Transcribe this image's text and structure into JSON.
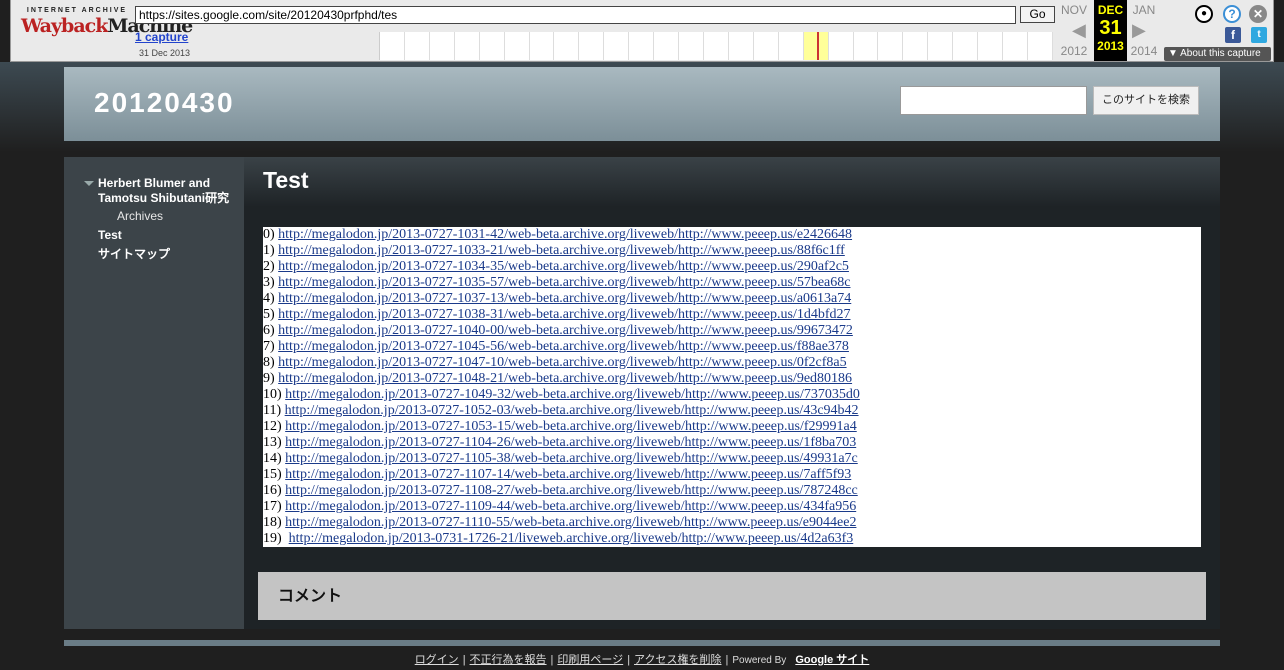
{
  "wayback": {
    "logo_top": "INTERNET ARCHIVE",
    "logo_main_a": "Wayback",
    "logo_main_b": "Machine",
    "url": "https://sites.google.com/site/20120430prfphd/tes",
    "go_label": "Go",
    "captures": "1 capture",
    "capture_date": "31 Dec 2013",
    "prev_month": "NOV",
    "prev_year": "2012",
    "cur_month": "DEC",
    "cur_day": "31",
    "cur_year": "2013",
    "next_month": "JAN",
    "next_year": "2014",
    "about": "About this capture"
  },
  "header": {
    "site_title": "20120430",
    "search_button": "このサイトを検索"
  },
  "sidebar": {
    "items": [
      {
        "label": "Herbert Blumer and"
      },
      {
        "label": "Tamotsu Shibutani研究"
      },
      {
        "label": "Archives"
      },
      {
        "label": "Test"
      },
      {
        "label": "サイトマップ"
      }
    ]
  },
  "page": {
    "title": "Test",
    "links": [
      {
        "n": "0)",
        "url": "http://megalodon.jp/2013-0727-1031-42/web-beta.archive.org/liveweb/http://www.peeep.us/e2426648"
      },
      {
        "n": "1)",
        "url": "http://megalodon.jp/2013-0727-1033-21/web-beta.archive.org/liveweb/http://www.peeep.us/88f6c1ff"
      },
      {
        "n": "2)",
        "url": "http://megalodon.jp/2013-0727-1034-35/web-beta.archive.org/liveweb/http://www.peeep.us/290af2c5"
      },
      {
        "n": "3)",
        "url": "http://megalodon.jp/2013-0727-1035-57/web-beta.archive.org/liveweb/http://www.peeep.us/57bea68c"
      },
      {
        "n": "4)",
        "url": "http://megalodon.jp/2013-0727-1037-13/web-beta.archive.org/liveweb/http://www.peeep.us/a0613a74"
      },
      {
        "n": "5)",
        "url": "http://megalodon.jp/2013-0727-1038-31/web-beta.archive.org/liveweb/http://www.peeep.us/1d4bfd27"
      },
      {
        "n": "6)",
        "url": "http://megalodon.jp/2013-0727-1040-00/web-beta.archive.org/liveweb/http://www.peeep.us/99673472"
      },
      {
        "n": "7)",
        "url": "http://megalodon.jp/2013-0727-1045-56/web-beta.archive.org/liveweb/http://www.peeep.us/f88ae378"
      },
      {
        "n": "8)",
        "url": "http://megalodon.jp/2013-0727-1047-10/web-beta.archive.org/liveweb/http://www.peeep.us/0f2cf8a5"
      },
      {
        "n": "9)",
        "url": "http://megalodon.jp/2013-0727-1048-21/web-beta.archive.org/liveweb/http://www.peeep.us/9ed80186"
      },
      {
        "n": "10)",
        "url": "http://megalodon.jp/2013-0727-1049-32/web-beta.archive.org/liveweb/http://www.peeep.us/737035d0"
      },
      {
        "n": "11)",
        "url": "http://megalodon.jp/2013-0727-1052-03/web-beta.archive.org/liveweb/http://www.peeep.us/43c94b42"
      },
      {
        "n": "12)",
        "url": "http://megalodon.jp/2013-0727-1053-15/web-beta.archive.org/liveweb/http://www.peeep.us/f29991a4"
      },
      {
        "n": "13)",
        "url": "http://megalodon.jp/2013-0727-1104-26/web-beta.archive.org/liveweb/http://www.peeep.us/1f8ba703"
      },
      {
        "n": "14)",
        "url": "http://megalodon.jp/2013-0727-1105-38/web-beta.archive.org/liveweb/http://www.peeep.us/49931a7c"
      },
      {
        "n": "15)",
        "url": "http://megalodon.jp/2013-0727-1107-14/web-beta.archive.org/liveweb/http://www.peeep.us/7aff5f93"
      },
      {
        "n": "16)",
        "url": "http://megalodon.jp/2013-0727-1108-27/web-beta.archive.org/liveweb/http://www.peeep.us/787248cc"
      },
      {
        "n": "17)",
        "url": "http://megalodon.jp/2013-0727-1109-44/web-beta.archive.org/liveweb/http://www.peeep.us/434fa956"
      },
      {
        "n": "18)",
        "url": "http://megalodon.jp/2013-0727-1110-55/web-beta.archive.org/liveweb/http://www.peeep.us/e9044ee2"
      },
      {
        "n": "19)",
        "url": "http://megalodon.jp/2013-0731-1726-21/liveweb.archive.org/liveweb/http://www.peeep.us/4d2a63f3"
      }
    ],
    "comments_title": "コメント"
  },
  "footer": {
    "login": "ログイン",
    "report": "不正行為を報告",
    "print": "印刷用ページ",
    "remove_access": "アクセス権を削除",
    "powered_by": "Powered By",
    "google_sites": "Google サイト"
  }
}
